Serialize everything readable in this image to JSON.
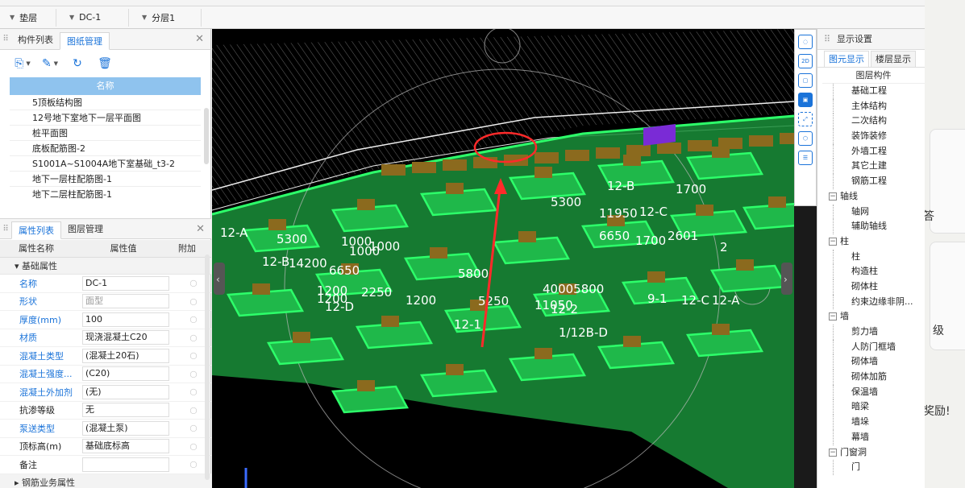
{
  "toolbar": {
    "combos": [
      {
        "label": "垫层"
      },
      {
        "label": "DC-1"
      },
      {
        "label": "分层1"
      }
    ]
  },
  "drawing_panel": {
    "tabs": [
      "构件列表",
      "图纸管理"
    ],
    "active_tab": "图纸管理",
    "list_header": "名称",
    "items": [
      "5顶板结构图",
      "12号地下室地下一层平面图",
      "桩平面图",
      "底板配筋图-2",
      "S1001A~S1004A地下室基础_t3-2",
      "地下一层柱配筋图-1",
      "地下二层柱配筋图-1"
    ]
  },
  "property_panel": {
    "tabs": [
      "属性列表",
      "图层管理"
    ],
    "active_tab": "属性列表",
    "col_name": "属性名称",
    "col_value": "属性值",
    "col_add": "附加",
    "group_basic": "基础属性",
    "rows": [
      {
        "name": "名称",
        "value": "DC-1",
        "link": true,
        "grey": false
      },
      {
        "name": "形状",
        "value": "面型",
        "link": true,
        "grey": true
      },
      {
        "name": "厚度(mm)",
        "value": "100",
        "link": true,
        "grey": false
      },
      {
        "name": "材质",
        "value": "现浇混凝土C20",
        "link": true,
        "grey": false
      },
      {
        "name": "混凝土类型",
        "value": "(混凝土20石)",
        "link": true,
        "grey": false
      },
      {
        "name": "混凝土强度...",
        "value": "(C20)",
        "link": true,
        "grey": false
      },
      {
        "name": "混凝土外加剂",
        "value": "(无)",
        "link": true,
        "grey": false
      },
      {
        "name": "抗渗等级",
        "value": "无",
        "link": false,
        "grey": false
      },
      {
        "name": "泵送类型",
        "value": "(混凝土泵)",
        "link": true,
        "grey": false
      },
      {
        "name": "顶标高(m)",
        "value": "基础底标高",
        "link": false,
        "grey": false
      },
      {
        "name": "备注",
        "value": "",
        "link": false,
        "grey": false
      }
    ],
    "group_rebar": "钢筋业务属性"
  },
  "viewport": {
    "labels": [
      "12-A",
      "12-B",
      "12-C",
      "12-D",
      "12-1",
      "12-2",
      "12-A",
      "12-B",
      "12-C",
      "9-1",
      "1/12B-D",
      "5300",
      "14200",
      "6650",
      "2250",
      "1200",
      "1000",
      "1000",
      "1000",
      "5800",
      "5250",
      "11050",
      "40005800",
      "5300",
      "11950",
      "6650",
      "1700",
      "1700",
      "2601",
      "2",
      "1200",
      "1200"
    ]
  },
  "display_panel": {
    "title": "显示设置",
    "tabs": [
      "图元显示",
      "楼层显示"
    ],
    "active_tab": "图元显示",
    "header": "图层构件",
    "tree": [
      {
        "label": "基础工程",
        "group": false
      },
      {
        "label": "主体结构",
        "group": false
      },
      {
        "label": "二次结构",
        "group": false
      },
      {
        "label": "装饰装修",
        "group": false
      },
      {
        "label": "外墙工程",
        "group": false
      },
      {
        "label": "其它土建",
        "group": false
      },
      {
        "label": "钢筋工程",
        "group": false
      },
      {
        "label": "轴线",
        "group": true
      },
      {
        "label": "轴网",
        "group": false
      },
      {
        "label": "辅助轴线",
        "group": false
      },
      {
        "label": "柱",
        "group": true
      },
      {
        "label": "柱",
        "group": false
      },
      {
        "label": "构造柱",
        "group": false
      },
      {
        "label": "砌体柱",
        "group": false
      },
      {
        "label": "约束边缘非阴...",
        "group": false
      },
      {
        "label": "墙",
        "group": true
      },
      {
        "label": "剪力墙",
        "group": false
      },
      {
        "label": "人防门框墙",
        "group": false
      },
      {
        "label": "砌体墙",
        "group": false
      },
      {
        "label": "砌体加筋",
        "group": false
      },
      {
        "label": "保温墙",
        "group": false
      },
      {
        "label": "暗梁",
        "group": false
      },
      {
        "label": "墙垛",
        "group": false
      },
      {
        "label": "幕墙",
        "group": false
      },
      {
        "label": "门窗洞",
        "group": true
      },
      {
        "label": "门",
        "group": false
      }
    ]
  },
  "background_app": {
    "snippets": [
      "答",
      "级",
      "奖励!"
    ]
  },
  "colors": {
    "accent": "#1a73d9",
    "slab_green": "#1fb84a",
    "slab_edge": "#2dff6a",
    "column_brown": "#8b6a1e",
    "annotation_red": "#ff2a2a"
  }
}
